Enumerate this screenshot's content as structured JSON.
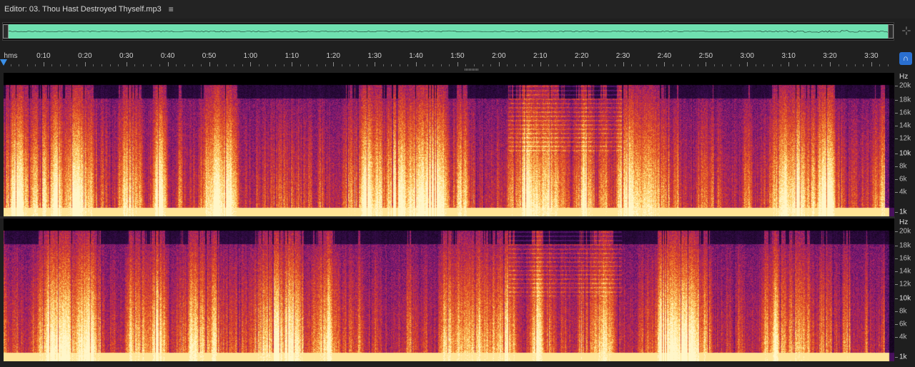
{
  "editor": {
    "title": "Editor: 03. Thou Hast Destroyed Thyself.mp3",
    "menu_icon": "hamburger-menu-icon"
  },
  "overview": {
    "color": "#6fe0b0",
    "zoom_icon": "zoom-navigator-icon"
  },
  "ruler": {
    "unit_label": "hms",
    "labels": [
      "0:10",
      "0:20",
      "0:30",
      "0:40",
      "0:50",
      "1:00",
      "1:10",
      "1:20",
      "1:30",
      "1:40",
      "1:50",
      "2:00",
      "2:10",
      "2:20",
      "2:30",
      "2:40",
      "2:50",
      "3:00",
      "3:10",
      "3:20",
      "3:30"
    ],
    "snap_icon": "magnet-snap-icon"
  },
  "spectral": {
    "unit": "Hz",
    "freq_labels": [
      "20k",
      "18k",
      "16k",
      "14k",
      "12k",
      "10k",
      "8k",
      "6k",
      "4k",
      "1k"
    ],
    "major_labels": [
      "10k",
      "1k"
    ],
    "palette": [
      "#000000",
      "#2b0a3d",
      "#5a1470",
      "#a0206a",
      "#d43a2a",
      "#f0782a",
      "#ffd66e",
      "#fff6c8"
    ]
  }
}
